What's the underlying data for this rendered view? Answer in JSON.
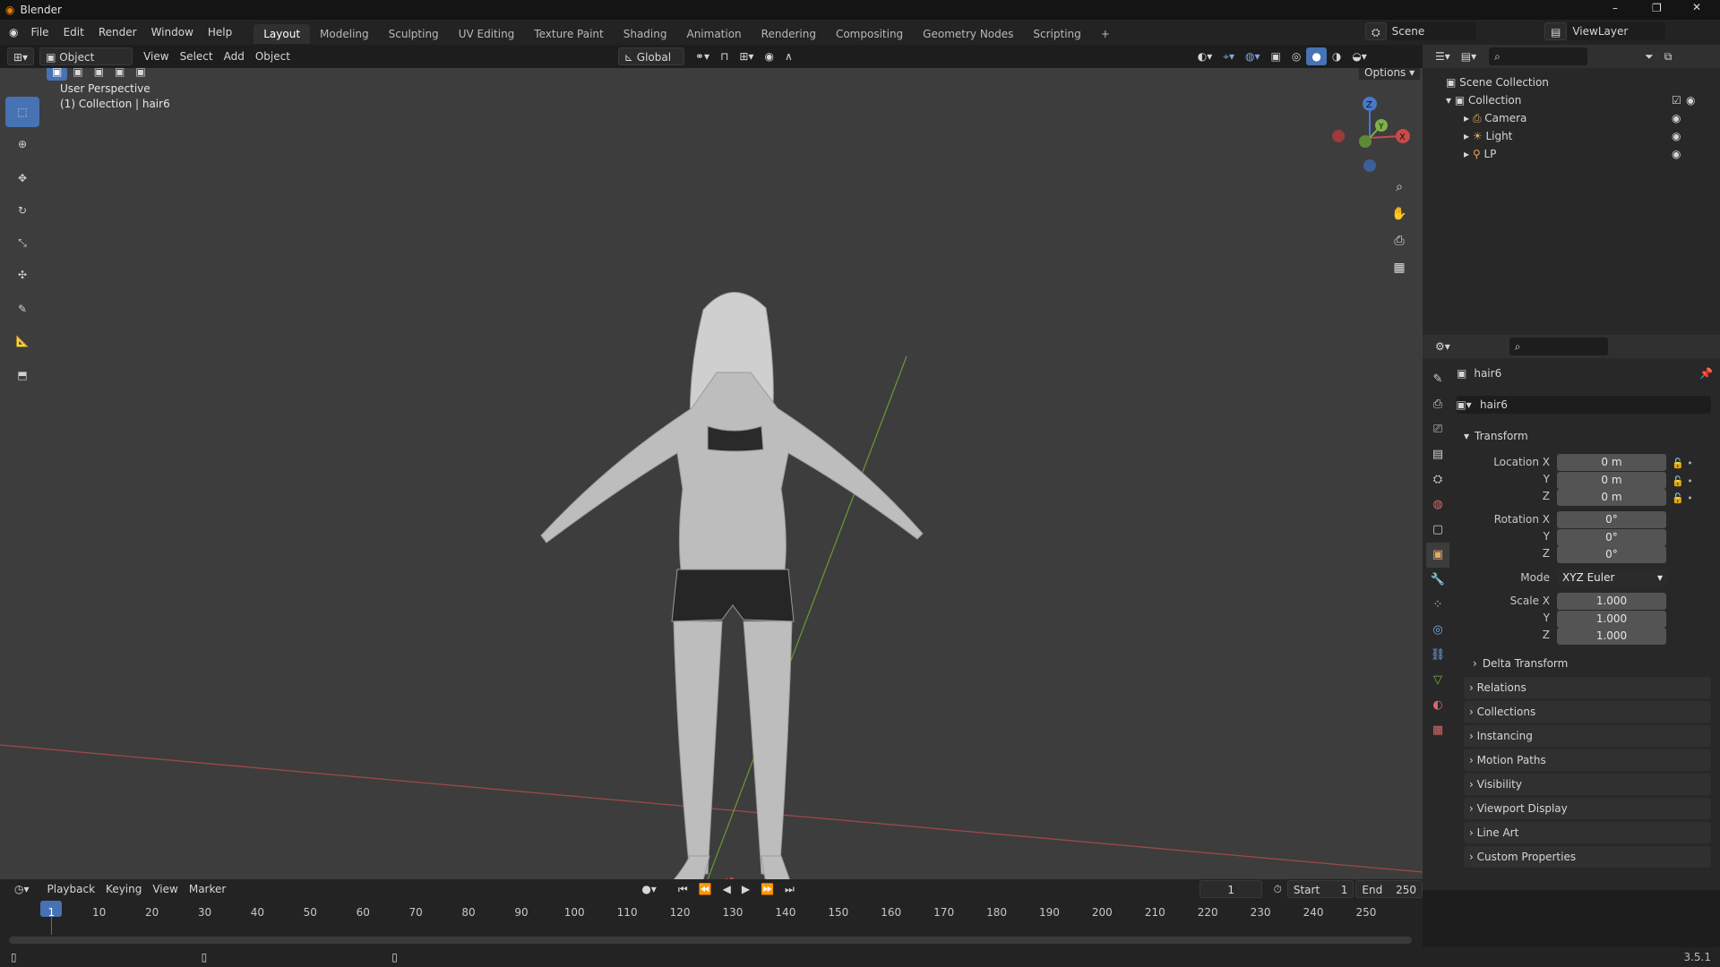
{
  "app": {
    "title": "Blender",
    "version": "3.5.1"
  },
  "menus": [
    "File",
    "Edit",
    "Render",
    "Window",
    "Help"
  ],
  "workspaces": [
    "Layout",
    "Modeling",
    "Sculpting",
    "UV Editing",
    "Texture Paint",
    "Shading",
    "Animation",
    "Rendering",
    "Compositing",
    "Geometry Nodes",
    "Scripting"
  ],
  "active_workspace": "Layout",
  "scene": {
    "name": "Scene",
    "view_layer": "ViewLayer"
  },
  "viewport": {
    "mode": "Object Mode",
    "menus": [
      "View",
      "Select",
      "Add",
      "Object"
    ],
    "orientation": "Global",
    "options_label": "Options",
    "overlay_line1": "User Perspective",
    "overlay_line2": "(1) Collection | hair6",
    "gizmo": {
      "x": "X",
      "y": "Y",
      "z": "Z"
    }
  },
  "outliner": {
    "root": "Scene Collection",
    "collection": "Collection",
    "items": [
      "Camera",
      "Light",
      "LP"
    ]
  },
  "properties": {
    "object_name": "hair6",
    "data_name": "hair6",
    "transform_title": "Transform",
    "location": {
      "label": "Location X",
      "x": "0 m",
      "y": "0 m",
      "z": "0 m"
    },
    "rotation": {
      "label": "Rotation X",
      "x": "0°",
      "y": "0°",
      "z": "0°"
    },
    "mode": {
      "label": "Mode",
      "value": "XYZ Euler"
    },
    "scale": {
      "label": "Scale X",
      "x": "1.000",
      "y": "1.000",
      "z": "1.000"
    },
    "axis_labels": {
      "y": "Y",
      "z": "Z"
    },
    "delta": "Delta Transform",
    "sections": [
      "Relations",
      "Collections",
      "Instancing",
      "Motion Paths",
      "Visibility",
      "Viewport Display",
      "Line Art",
      "Custom Properties"
    ]
  },
  "timeline": {
    "menus": [
      "Playback",
      "Keying",
      "View",
      "Marker"
    ],
    "current_frame": "1",
    "start_label": "Start",
    "start": "1",
    "end_label": "End",
    "end": "250",
    "ticks": [
      "1",
      "10",
      "20",
      "30",
      "40",
      "50",
      "60",
      "70",
      "80",
      "90",
      "100",
      "110",
      "120",
      "130",
      "140",
      "150",
      "160",
      "170",
      "180",
      "190",
      "200",
      "210",
      "220",
      "230",
      "240",
      "250"
    ]
  },
  "colors": {
    "accent": "#4772b3",
    "x_axis": "#c84a4a",
    "y_axis": "#7fb04a",
    "z_axis": "#4a78c8"
  }
}
